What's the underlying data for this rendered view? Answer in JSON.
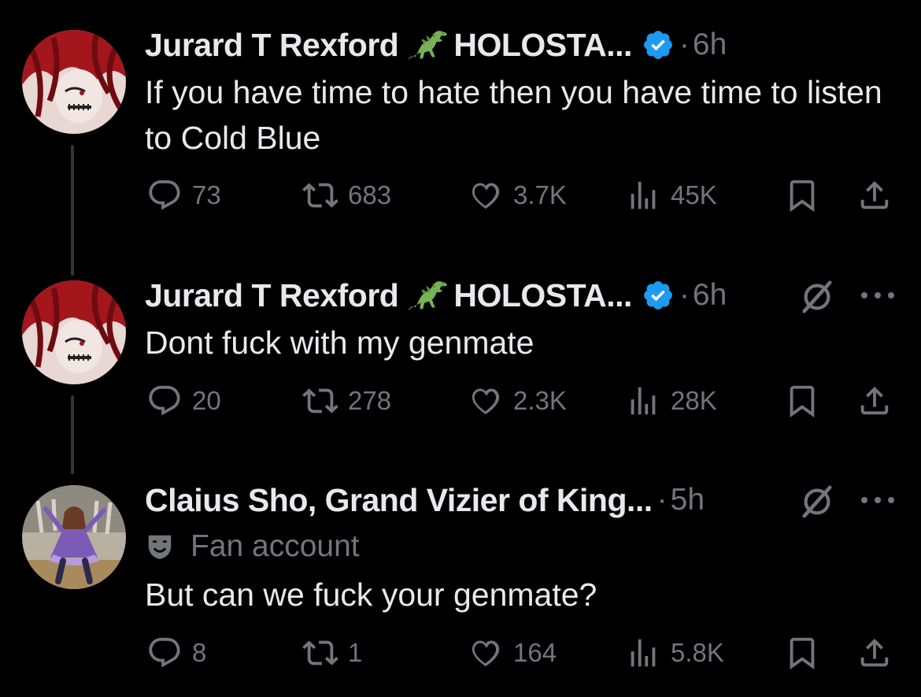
{
  "tweets": [
    {
      "author": "Jurard T Rexford",
      "handle_suffix": "HOLOSTA...",
      "verified": true,
      "dot": "·",
      "time": "6h",
      "text": "If you have time to hate then you have time to listen to Cold Blue",
      "replies": "73",
      "reposts": "683",
      "likes": "3.7K",
      "views": "45K"
    },
    {
      "author": "Jurard T Rexford",
      "handle_suffix": "HOLOSTA...",
      "verified": true,
      "dot": "·",
      "time": "6h",
      "text": "Dont fuck with my genmate",
      "replies": "20",
      "reposts": "278",
      "likes": "2.3K",
      "views": "28K"
    },
    {
      "author": "Claius Sho, Grand Vizier of King...",
      "dot": "·",
      "time": "5h",
      "label": "Fan account",
      "text": "But can we fuck your genmate?",
      "replies": "8",
      "reposts": "1",
      "likes": "164",
      "views": "5.8K"
    }
  ],
  "colors": {
    "background": "#000000",
    "text": "#e7e9ea",
    "muted": "#71767b",
    "verified": "#1d9bf0"
  },
  "icons": [
    "reply-icon",
    "repost-icon",
    "like-icon",
    "views-icon",
    "bookmark-icon",
    "share-icon",
    "grok-icon",
    "more-icon",
    "verified-icon",
    "dinosaur-emoji",
    "fan-mask-icon"
  ]
}
